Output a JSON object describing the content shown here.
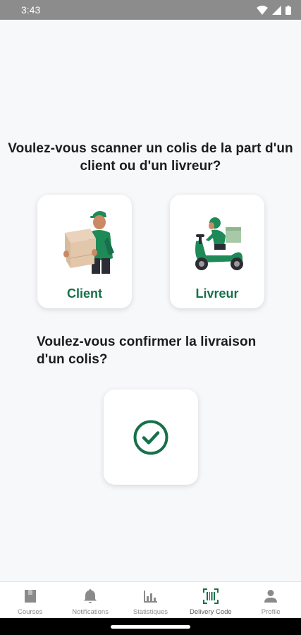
{
  "status_bar": {
    "time": "3:43"
  },
  "main": {
    "scan_question": "Voulez-vous scanner un colis de la part d'un client ou d'un livreur?",
    "client_label": "Client",
    "livreur_label": "Livreur",
    "confirm_question": "Voulez-vous confirmer la livraison d'un colis?"
  },
  "bottom_nav": {
    "items": [
      {
        "label": "Courses",
        "icon": "bag-icon"
      },
      {
        "label": "Notifications",
        "icon": "bell-icon"
      },
      {
        "label": "Statistiques",
        "icon": "bar-chart-icon"
      },
      {
        "label": "Delivery Code",
        "icon": "barcode-scan-icon"
      },
      {
        "label": "Profile",
        "icon": "person-icon"
      }
    ],
    "active_index": 3
  },
  "colors": {
    "accent": "#17704a",
    "nav_inactive": "#8a8a8a"
  }
}
